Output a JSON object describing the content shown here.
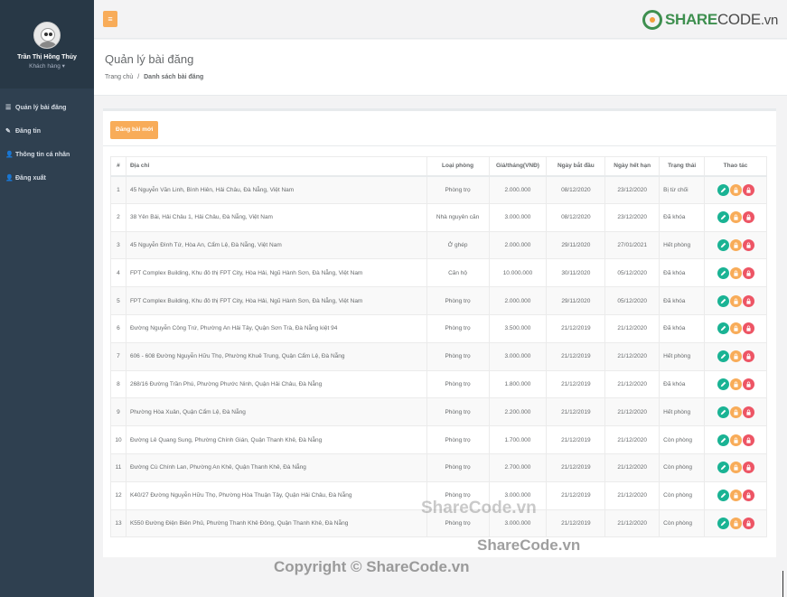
{
  "sidebar": {
    "user_name": "Trần Thị Hồng Thủy",
    "user_role": "Khách hàng ▾",
    "items": [
      {
        "label": "Quản lý bài đăng",
        "icon": "list-icon"
      },
      {
        "label": "Đăng tin",
        "icon": "pencil-icon"
      },
      {
        "label": "Thông tin cá nhân",
        "icon": "user-icon"
      },
      {
        "label": "Đăng xuất",
        "icon": "logout-icon"
      }
    ]
  },
  "header": {
    "menu_icon": "hamburger-icon",
    "logo_share": "SHARE",
    "logo_code": "CODE",
    "logo_vn": ".vn"
  },
  "page": {
    "title": "Quản lý bài đăng",
    "breadcrumb_home": "Trang chủ",
    "breadcrumb_sep": "/",
    "breadcrumb_current": "Danh sách bài đăng"
  },
  "toolbar": {
    "new_post_label": "Đăng bài mới"
  },
  "table": {
    "columns": [
      "#",
      "Địa chỉ",
      "Loại phòng",
      "Giá/tháng(VNĐ)",
      "Ngày bắt đầu",
      "Ngày hết hạn",
      "Trạng thái",
      "Thao tác"
    ],
    "rows": [
      {
        "no": "1",
        "address": "45 Nguyễn Văn Linh, Bình Hiên, Hải Châu, Đà Nẵng, Việt Nam",
        "type": "Phòng trọ",
        "price": "2.000.000",
        "start": "08/12/2020",
        "end": "23/12/2020",
        "status": "Bị từ chối"
      },
      {
        "no": "2",
        "address": "38 Yên Bái, Hải Châu 1, Hải Châu, Đà Nẵng, Việt Nam",
        "type": "Nhà nguyên căn",
        "price": "3.000.000",
        "start": "08/12/2020",
        "end": "23/12/2020",
        "status": "Đã khóa"
      },
      {
        "no": "3",
        "address": "45 Nguyễn Đình Tứ, Hòa An, Cẩm Lệ, Đà Nẵng, Việt Nam",
        "type": "Ở ghép",
        "price": "2.000.000",
        "start": "29/11/2020",
        "end": "27/01/2021",
        "status": "Hết phòng"
      },
      {
        "no": "4",
        "address": "FPT Complex Building, Khu đô thị FPT City, Hòa Hải, Ngũ Hành Sơn, Đà Nẵng, Việt Nam",
        "type": "Căn hộ",
        "price": "10.000.000",
        "start": "30/11/2020",
        "end": "05/12/2020",
        "status": "Đã khóa"
      },
      {
        "no": "5",
        "address": "FPT Complex Building, Khu đô thị FPT City, Hòa Hải, Ngũ Hành Sơn, Đà Nẵng, Việt Nam",
        "type": "Phòng trọ",
        "price": "2.000.000",
        "start": "29/11/2020",
        "end": "05/12/2020",
        "status": "Đã khóa"
      },
      {
        "no": "6",
        "address": "Đường Nguyễn Công Trứ, Phường An Hải Tây, Quận Sơn Trà, Đà Nẵng kiệt 94",
        "type": "Phòng trọ",
        "price": "3.500.000",
        "start": "21/12/2019",
        "end": "21/12/2020",
        "status": "Đã khóa"
      },
      {
        "no": "7",
        "address": "606 - 608 Đường Nguyễn Hữu Thọ, Phường Khuê Trung, Quận Cẩm Lệ, Đà Nẵng",
        "type": "Phòng trọ",
        "price": "3.000.000",
        "start": "21/12/2019",
        "end": "21/12/2020",
        "status": "Hết phòng"
      },
      {
        "no": "8",
        "address": "268/16 Đường Trần Phú, Phường Phước Ninh, Quận Hải Châu, Đà Nẵng",
        "type": "Phòng trọ",
        "price": "1.800.000",
        "start": "21/12/2019",
        "end": "21/12/2020",
        "status": "Đã khóa"
      },
      {
        "no": "9",
        "address": "Phường Hòa Xuân, Quận Cẩm Lệ, Đà Nẵng",
        "type": "Phòng trọ",
        "price": "2.200.000",
        "start": "21/12/2019",
        "end": "21/12/2020",
        "status": "Hết phòng"
      },
      {
        "no": "10",
        "address": "Đường Lê Quang Sung, Phường Chính Gián, Quận Thanh Khê, Đà Nẵng",
        "type": "Phòng trọ",
        "price": "1.700.000",
        "start": "21/12/2019",
        "end": "21/12/2020",
        "status": "Còn phòng"
      },
      {
        "no": "11",
        "address": "Đường Cù Chính Lan, Phường An Khê, Quận Thanh Khê, Đà Nẵng",
        "type": "Phòng trọ",
        "price": "2.700.000",
        "start": "21/12/2019",
        "end": "21/12/2020",
        "status": "Còn phòng"
      },
      {
        "no": "12",
        "address": "K40/27 Đường Nguyễn Hữu Thọ, Phường Hòa Thuận Tây, Quận Hải Châu, Đà Nẵng",
        "type": "Phòng trọ",
        "price": "3.000.000",
        "start": "21/12/2019",
        "end": "21/12/2020",
        "status": "Còn phòng"
      },
      {
        "no": "13",
        "address": "K550 Đường Điện Biên Phủ, Phường Thanh Khê Đông, Quận Thanh Khê, Đà Nẵng",
        "type": "Phòng trọ",
        "price": "3.000.000",
        "start": "21/12/2019",
        "end": "21/12/2020",
        "status": "Còn phòng"
      }
    ],
    "action_icons": [
      "edit-icon",
      "lock-icon",
      "unlock-icon"
    ]
  },
  "colors": {
    "sidebar": "#2f4050",
    "accent_orange": "#f8ac59",
    "edit_green": "#1ab394",
    "delete_red": "#ed5565",
    "brand_green": "#3e8f4f"
  },
  "watermarks": {
    "center": "ShareCode.vn",
    "lower": "ShareCode.vn",
    "copyright": "Copyright © ShareCode.vn"
  }
}
